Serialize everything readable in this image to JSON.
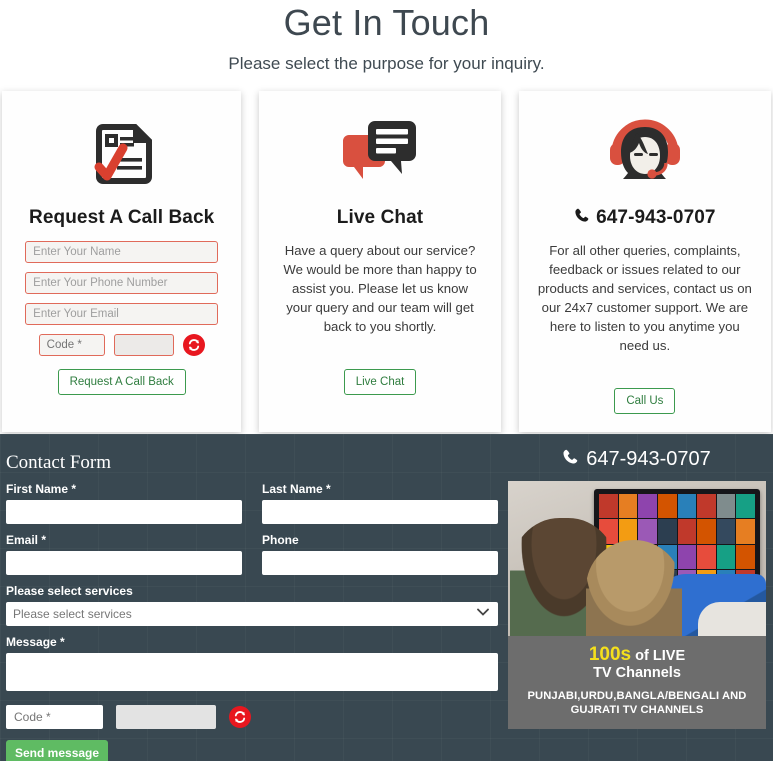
{
  "hero": {
    "title": "Get In Touch",
    "subtitle": "Please select the purpose for your inquiry."
  },
  "cards": [
    {
      "icon": "document-check-icon",
      "title": "Request A Call Back",
      "fields": [
        {
          "name": "name-input",
          "placeholder": "Enter Your Name",
          "value": ""
        },
        {
          "name": "phone-input",
          "placeholder": "Enter Your Phone Number",
          "value": ""
        },
        {
          "name": "email-input",
          "placeholder": "Enter Your Email",
          "value": ""
        }
      ],
      "captcha": {
        "placeholder": "Code *",
        "value": "",
        "refresh_icon": "refresh-icon"
      },
      "button": "Request A Call Back"
    },
    {
      "icon": "chat-bubbles-icon",
      "title": "Live Chat",
      "body": "Have a query about our service? We would be more than happy to assist you. Please let us know your query and our team will get back to you shortly.",
      "button": "Live Chat"
    },
    {
      "icon": "headset-agent-icon",
      "phone_icon": "phone-icon",
      "title": "647-943-0707",
      "body": "For all other queries, complaints, feedback or issues related to our products and services, contact us on our 24x7 customer support. We are here to listen to you anytime you need us.",
      "button": "Call Us"
    }
  ],
  "contact_form": {
    "heading": "Contact Form",
    "labels": {
      "first_name": "First Name *",
      "last_name": "Last Name *",
      "email": "Email *",
      "phone": "Phone",
      "services": "Please select services",
      "message": "Message *"
    },
    "values": {
      "first_name": "",
      "last_name": "",
      "email": "",
      "phone": "",
      "message": ""
    },
    "services_selected": "Please select services",
    "captcha": {
      "placeholder": "Code *",
      "value": "",
      "refresh_icon": "refresh-icon"
    },
    "submit": "Send message"
  },
  "promo": {
    "phone_icon": "phone-icon",
    "phone": "647-943-0707",
    "image_alt": "couple-watching-tv-image",
    "caption_number": "100s",
    "caption_rest": " of LIVE",
    "caption_line2": "TV Channels",
    "caption_line3": "PUNJABI,URDU,BANGLA/BENGALI AND GUJRATI TV CHANNELS"
  },
  "colors": {
    "dark_bg": "#394851",
    "accent_red": "#e1503c",
    "accent_green": "#3c9a4e",
    "send_green": "#5fbb63",
    "refresh_red": "#e8171f",
    "caption_yellow": "#f5e01c",
    "caption_bg": "#6d6d6d"
  }
}
